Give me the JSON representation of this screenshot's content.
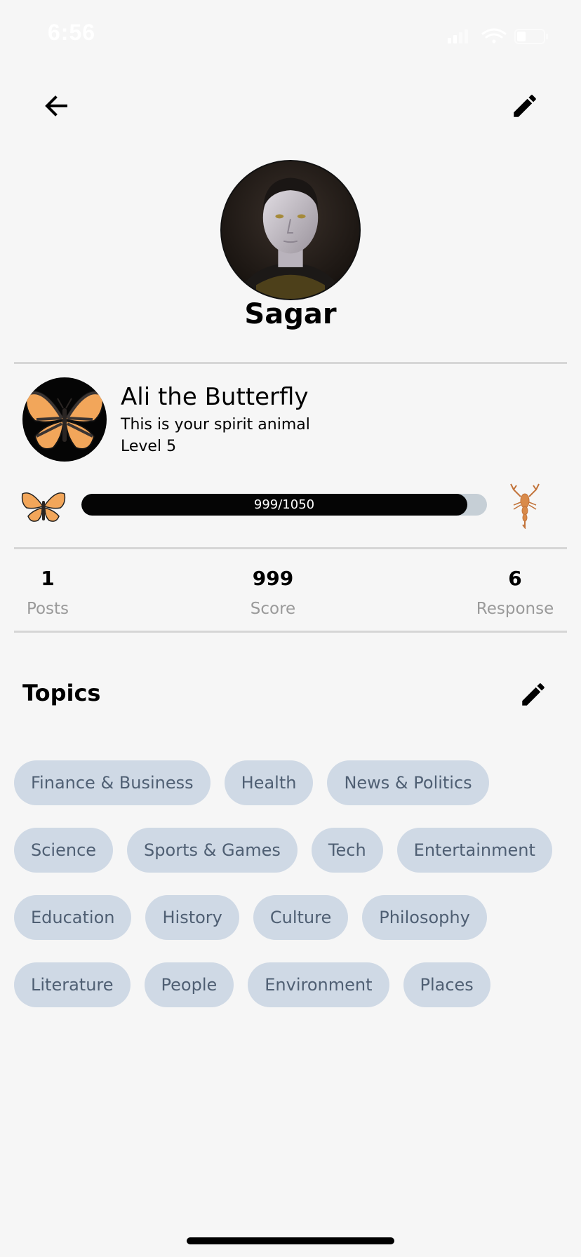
{
  "status_bar": {
    "time": "6:56"
  },
  "header": {
    "back_icon": "arrow-left-icon",
    "edit_icon": "pencil-icon"
  },
  "profile": {
    "username": "Sagar"
  },
  "spirit": {
    "name": "Ali the Butterfly",
    "subtitle": "This is your spirit animal",
    "level": "Level 5"
  },
  "progress": {
    "label": "999/1050",
    "current": 999,
    "max": 1050,
    "current_icon": "butterfly-icon",
    "next_icon": "scorpion-icon"
  },
  "stats": [
    {
      "value": "1",
      "label": "Posts"
    },
    {
      "value": "999",
      "label": "Score"
    },
    {
      "value": "6",
      "label": "Response"
    }
  ],
  "topics": {
    "title": "Topics",
    "rows": [
      [
        "Finance & Business",
        "Health",
        "News & Politics"
      ],
      [
        "Science",
        "Sports & Games",
        "Tech",
        "Entertainment"
      ],
      [
        "Education",
        "History",
        "Culture",
        "Philosophy"
      ],
      [
        "Literature",
        "People",
        "Environment",
        "Places"
      ]
    ]
  },
  "colors": {
    "background": "#f6f6f6",
    "chip_background": "#cfd9e5",
    "chip_text": "#4f5f73",
    "progress_fill": "#050505",
    "progress_track": "#c6cfd6",
    "butterfly_orange": "#f2a65a",
    "scorpion_orange": "#d98a4a"
  }
}
